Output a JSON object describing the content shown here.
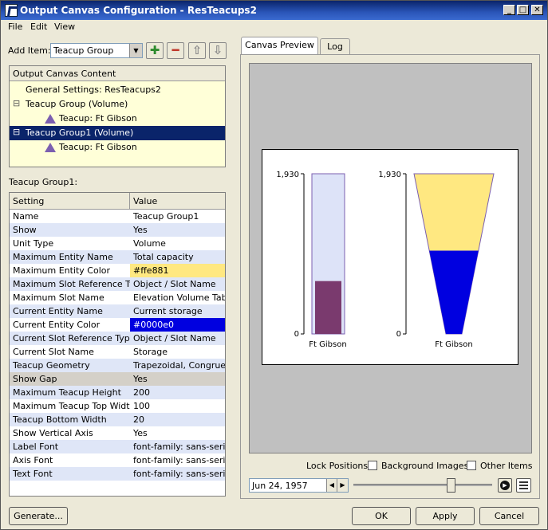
{
  "window": {
    "title": "Output Canvas Configuration - ResTeacups2",
    "controls": [
      "_",
      "□",
      "✕"
    ]
  },
  "menu": [
    "File",
    "Edit",
    "View"
  ],
  "add_item": {
    "label": "Add Item:",
    "selected": "Teacup Group",
    "buttons": [
      {
        "icon": "plus-icon",
        "glyph": "✚",
        "color": "#2e8b2e"
      },
      {
        "icon": "minus-icon",
        "glyph": "━",
        "color": "#c0392b"
      },
      {
        "icon": "arrow-up-icon",
        "glyph": "⇧",
        "color": "#8a8a8a"
      },
      {
        "icon": "arrow-down-icon",
        "glyph": "⇩",
        "color": "#8a8a8a"
      }
    ]
  },
  "content_tree": {
    "header": "Output Canvas Content",
    "rows": [
      {
        "label": "General Settings: ResTeacups2",
        "level": 0,
        "expander": "",
        "icon": false,
        "selected": false
      },
      {
        "label": "Teacup Group (Volume)",
        "level": 0,
        "expander": "⊟",
        "icon": false,
        "selected": false
      },
      {
        "label": "Teacup: Ft Gibson",
        "level": 1,
        "expander": "",
        "icon": true,
        "selected": false
      },
      {
        "label": "Teacup Group1 (Volume)",
        "level": 0,
        "expander": "⊟",
        "icon": false,
        "selected": true
      },
      {
        "label": "Teacup: Ft Gibson",
        "level": 1,
        "expander": "",
        "icon": true,
        "selected": false
      }
    ]
  },
  "properties": {
    "title": "Teacup Group1:",
    "columns": [
      "Setting",
      "Value"
    ],
    "rows": [
      {
        "setting": "Name",
        "value": "Teacup Group1",
        "bg": "#ffffff",
        "value_bg": "",
        "value_color": "#000000"
      },
      {
        "setting": "Show",
        "value": "Yes",
        "bg": "#dfe6f7",
        "value_bg": "",
        "value_color": "#000000"
      },
      {
        "setting": "Unit Type",
        "value": "Volume",
        "bg": "#ffffff",
        "value_bg": "",
        "value_color": "#000000"
      },
      {
        "setting": "Maximum Entity Name",
        "value": "Total capacity",
        "bg": "#dfe6f7",
        "value_bg": "",
        "value_color": "#000000"
      },
      {
        "setting": "Maximum Entity Color",
        "value": "#ffe881",
        "bg": "#ffffff",
        "value_bg": "#ffe881",
        "value_color": "#000000"
      },
      {
        "setting": "Maximum Slot Reference Type",
        "value": "Object / Slot Name",
        "bg": "#dfe6f7",
        "value_bg": "",
        "value_color": "#000000"
      },
      {
        "setting": "Maximum Slot Name",
        "value": "Elevation Volume Table",
        "bg": "#ffffff",
        "value_bg": "",
        "value_color": "#000000"
      },
      {
        "setting": "Current Entity Name",
        "value": "Current storage",
        "bg": "#dfe6f7",
        "value_bg": "",
        "value_color": "#000000"
      },
      {
        "setting": "Current Entity Color",
        "value": "#0000e0",
        "bg": "#ffffff",
        "value_bg": "#0000e0",
        "value_color": "#ffffff"
      },
      {
        "setting": "Current Slot Reference Type",
        "value": "Object / Slot Name",
        "bg": "#dfe6f7",
        "value_bg": "",
        "value_color": "#000000"
      },
      {
        "setting": "Current Slot Name",
        "value": "Storage",
        "bg": "#ffffff",
        "value_bg": "",
        "value_color": "#000000"
      },
      {
        "setting": "Teacup Geometry",
        "value": "Trapezoidal, Congruent",
        "bg": "#dfe6f7",
        "value_bg": "",
        "value_color": "#000000"
      },
      {
        "setting": "Show Gap",
        "value": "Yes",
        "bg": "#d4d0c8",
        "value_bg": "",
        "value_color": "#000000"
      },
      {
        "setting": "Maximum Teacup Height",
        "value": "200",
        "bg": "#dfe6f7",
        "value_bg": "",
        "value_color": "#000000"
      },
      {
        "setting": "Maximum Teacup Top Width",
        "value": "100",
        "bg": "#ffffff",
        "value_bg": "",
        "value_color": "#000000"
      },
      {
        "setting": "Teacup Bottom Width",
        "value": "20",
        "bg": "#dfe6f7",
        "value_bg": "",
        "value_color": "#000000"
      },
      {
        "setting": "Show Vertical Axis",
        "value": "Yes",
        "bg": "#ffffff",
        "value_bg": "",
        "value_color": "#000000"
      },
      {
        "setting": "Label Font",
        "value": "font-family: sans-serif;",
        "bg": "#dfe6f7",
        "value_bg": "",
        "value_color": "#000000"
      },
      {
        "setting": "Axis Font",
        "value": "font-family: sans-serif;",
        "bg": "#ffffff",
        "value_bg": "",
        "value_color": "#000000"
      },
      {
        "setting": "Text Font",
        "value": "font-family: sans-serif;",
        "bg": "#dfe6f7",
        "value_bg": "",
        "value_color": "#000000"
      }
    ]
  },
  "tabs": [
    {
      "label": "Canvas Preview",
      "active": true
    },
    {
      "label": "Log",
      "active": false
    }
  ],
  "preview": {
    "teacups": [
      {
        "type": "rectangular",
        "axis_max": "1,930",
        "axis_min": "0",
        "label": "Ft Gibson",
        "fill_fraction": 0.33,
        "max_color": "#dde3f8",
        "current_color": "#7a3a6e"
      },
      {
        "type": "trapezoidal",
        "axis_max": "1,930",
        "axis_min": "0",
        "label": "Ft Gibson",
        "fill_fraction": 0.52,
        "max_color": "#ffe881",
        "current_color": "#0000e0"
      }
    ]
  },
  "lock_positions": {
    "label": "Lock Positions:",
    "options": [
      {
        "label": "Background Images",
        "checked": false
      },
      {
        "label": "Other Items",
        "checked": false
      }
    ]
  },
  "playback": {
    "date": "Jun 24, 1957",
    "slider_position": 0.7,
    "play_icon": "play-icon",
    "text_icon": "text-lines-icon"
  },
  "buttons": {
    "generate": "Generate...",
    "ok": "OK",
    "apply": "Apply",
    "cancel": "Cancel"
  }
}
